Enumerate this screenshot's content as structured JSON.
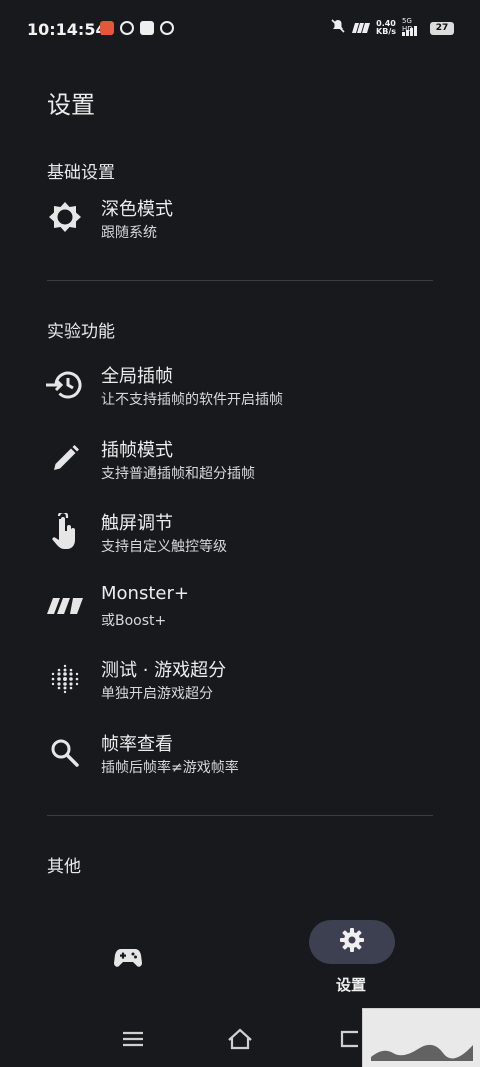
{
  "status_bar": {
    "time": "10:14:54",
    "app_icons": [
      "notification-app-red",
      "notification-app-link",
      "notification-app-mail",
      "notification-app-game"
    ],
    "net_speed_value": "0.40",
    "net_speed_unit": "KB/s",
    "signal_label": "5G HD",
    "battery": "27"
  },
  "page": {
    "title": "设置"
  },
  "sections": {
    "basic": "基础设置",
    "experimental": "实验功能",
    "other": "其他"
  },
  "basic_items": [
    {
      "title": "深色模式",
      "subtitle": "跟随系统",
      "icon": "dark-mode-icon"
    }
  ],
  "experimental_items": [
    {
      "title": "全局插帧",
      "subtitle": "让不支持插帧的软件开启插帧",
      "icon": "history-clock-icon"
    },
    {
      "title": "插帧模式",
      "subtitle": "支持普通插帧和超分插帧",
      "icon": "pencil-icon"
    },
    {
      "title": "触屏调节",
      "subtitle": "支持自定义触控等级",
      "icon": "touch-hand-icon"
    },
    {
      "title": "Monster+",
      "subtitle": "或Boost+",
      "icon": "monster-logo-icon"
    },
    {
      "title": "测试 · 游戏超分",
      "subtitle": "单独开启游戏超分",
      "icon": "dots-grid-icon"
    },
    {
      "title": "帧率查看",
      "subtitle": "插帧后帧率≠游戏帧率",
      "icon": "search-icon"
    }
  ],
  "bottom_nav": {
    "games_icon": "gamepad-icon",
    "settings_label": "设置",
    "settings_icon": "gear-icon"
  },
  "colors": {
    "background": "#18191d",
    "divider": "#3b3c42",
    "nav_pill": "#3d4050",
    "text": "#ededed"
  }
}
